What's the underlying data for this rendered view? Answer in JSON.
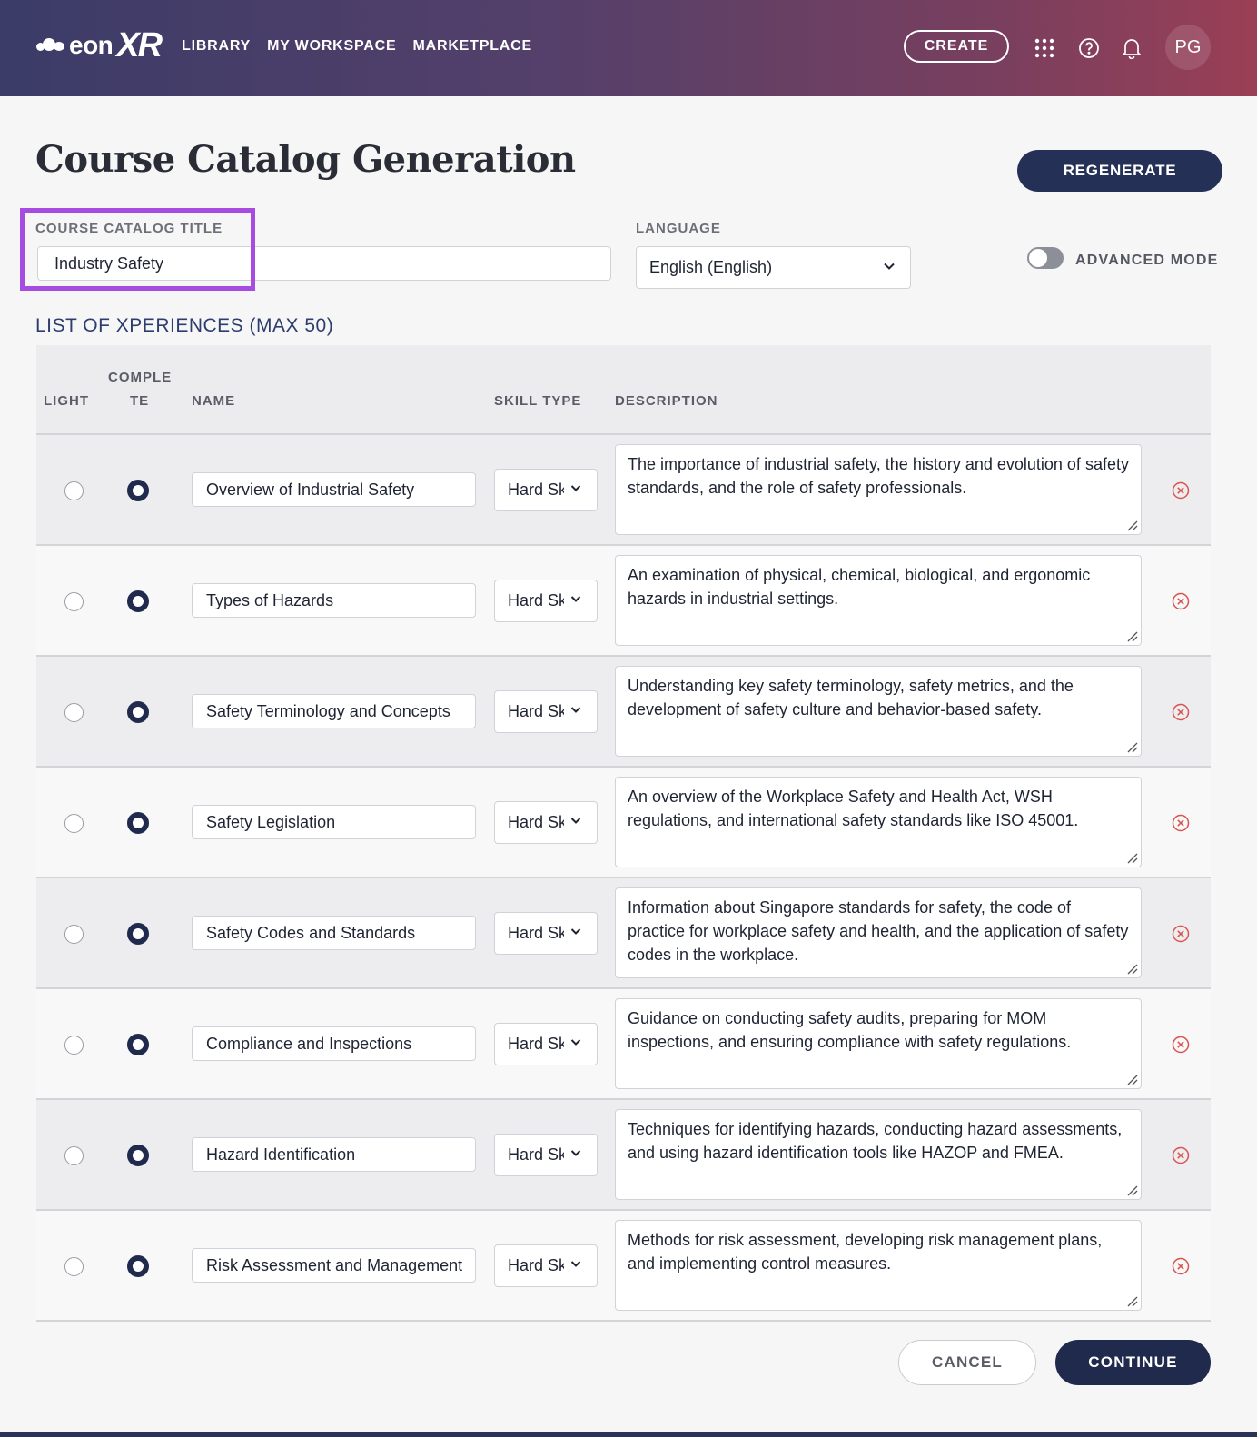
{
  "header": {
    "logo_text": "eon",
    "logo_xr": "XR",
    "nav": [
      "LIBRARY",
      "MY WORKSPACE",
      "MARKETPLACE"
    ],
    "create_label": "CREATE",
    "apps_icon": "grid-icon",
    "help_icon": "help-icon",
    "bell_icon": "bell-icon",
    "avatar_initials": "PG"
  },
  "page": {
    "title": "Course Catalog Generation",
    "regenerate_label": "REGENERATE"
  },
  "form": {
    "catalog_title_label": "COURSE CATALOG TITLE",
    "catalog_title_value": "Industry Safety",
    "language_label": "LANGUAGE",
    "language_value": "English (English)",
    "advanced_mode_label": "ADVANCED MODE",
    "advanced_mode_on": false
  },
  "list": {
    "title": "LIST OF XPERIENCES (MAX 50)",
    "columns": {
      "light": "LIGHT",
      "complete_line1": "COMPLE",
      "complete_line2": "TE",
      "name": "NAME",
      "skill_type": "SKILL TYPE",
      "description": "DESCRIPTION"
    },
    "rows": [
      {
        "name": "Overview of Industrial Safety",
        "skill": "Hard Skill",
        "selected": "complete",
        "description": "The importance of industrial safety, the history and evolution of safety standards, and the role of safety professionals."
      },
      {
        "name": "Types of Hazards",
        "skill": "Hard Skill",
        "selected": "complete",
        "description": "An examination of physical, chemical, biological, and ergonomic hazards in industrial settings."
      },
      {
        "name": "Safety Terminology and Concepts",
        "skill": "Hard Skill",
        "selected": "complete",
        "description": "Understanding key safety terminology, safety metrics, and the development of safety culture and behavior-based safety."
      },
      {
        "name": "Safety Legislation",
        "skill": "Hard Skill",
        "selected": "complete",
        "description": "An overview of the Workplace Safety and Health Act, WSH regulations, and international safety standards like ISO 45001."
      },
      {
        "name": "Safety Codes and Standards",
        "skill": "Hard Skill",
        "selected": "complete",
        "description": "Information about Singapore standards for safety, the code of practice for workplace safety and health, and the application of safety codes in the workplace."
      },
      {
        "name": "Compliance and Inspections",
        "skill": "Hard Skill",
        "selected": "complete",
        "description": "Guidance on conducting safety audits, preparing for MOM inspections, and ensuring compliance with safety regulations."
      },
      {
        "name": "Hazard Identification",
        "skill": "Hard Skill",
        "selected": "complete",
        "description": "Techniques for identifying hazards, conducting hazard assessments, and using hazard identification tools like HAZOP and FMEA."
      },
      {
        "name": "Risk Assessment and Management",
        "skill": "Hard Skill",
        "selected": "complete",
        "description": "Methods for risk assessment, developing risk management plans, and implementing control measures."
      }
    ]
  },
  "footer": {
    "cancel_label": "CANCEL",
    "continue_label": "CONTINUE"
  },
  "colors": {
    "primary": "#1f2a4c",
    "highlight": "#a64ce0",
    "delete": "#d9534f"
  }
}
